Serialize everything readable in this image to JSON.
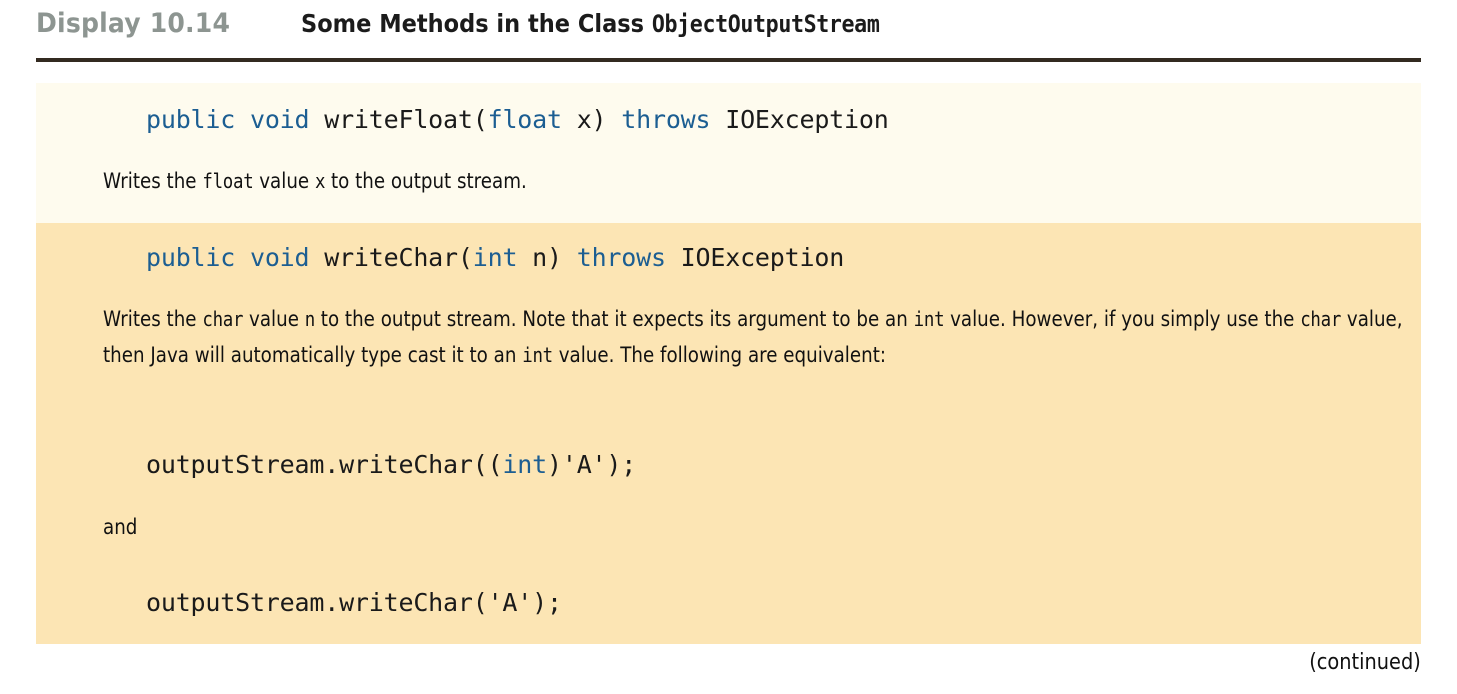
{
  "header": {
    "display_label": "Display 10.14",
    "title_text": "Some Methods in the Class ",
    "title_class_name": "ObjectOutputStream"
  },
  "colors": {
    "cream_block": "#fefbee",
    "tan_block": "#fce5b4",
    "rule": "#332a20",
    "display_label": "#8d9591",
    "keyword_blue": "#1c5e92",
    "body_text": "#111111"
  },
  "blocks": [
    {
      "id": "writeFloat",
      "background": "cream",
      "signature": {
        "parts": [
          {
            "text": "public",
            "kind": "keyword"
          },
          {
            "text": " ",
            "kind": "plain"
          },
          {
            "text": "void",
            "kind": "keyword"
          },
          {
            "text": " writeFloat(",
            "kind": "plain"
          },
          {
            "text": "float",
            "kind": "keyword"
          },
          {
            "text": " x) ",
            "kind": "plain"
          },
          {
            "text": "throws",
            "kind": "keyword"
          },
          {
            "text": " IOException",
            "kind": "plain"
          }
        ],
        "plain_text": "public void writeFloat(float x) throws IOException"
      },
      "description": "Writes the float value x to the output stream.",
      "description_parts": [
        {
          "text": "Writes the ",
          "kind": "prose"
        },
        {
          "text": "float",
          "kind": "code"
        },
        {
          "text": " value ",
          "kind": "prose"
        },
        {
          "text": "x",
          "kind": "code"
        },
        {
          "text": " to the output stream.",
          "kind": "prose"
        }
      ]
    },
    {
      "id": "writeChar",
      "background": "tan",
      "signature": {
        "parts": [
          {
            "text": "public",
            "kind": "keyword"
          },
          {
            "text": " ",
            "kind": "plain"
          },
          {
            "text": "void",
            "kind": "keyword"
          },
          {
            "text": " writeChar(",
            "kind": "plain"
          },
          {
            "text": "int",
            "kind": "keyword"
          },
          {
            "text": " n) ",
            "kind": "plain"
          },
          {
            "text": "throws",
            "kind": "keyword"
          },
          {
            "text": " IOException",
            "kind": "plain"
          }
        ],
        "plain_text": "public void writeChar(int n) throws IOException"
      },
      "description": "Writes the char value n to the output stream. Note that it expects its argument to be an int value. However, if you simply use the char value, then Java will automatically type cast it to an int value. The following are equivalent:",
      "description_parts": [
        {
          "text": "Writes the ",
          "kind": "prose"
        },
        {
          "text": "char",
          "kind": "code"
        },
        {
          "text": " value ",
          "kind": "prose"
        },
        {
          "text": "n",
          "kind": "code"
        },
        {
          "text": " to the output stream. Note that it expects its argument to be an ",
          "kind": "prose"
        },
        {
          "text": "int",
          "kind": "code"
        },
        {
          "text": " value. However, if you simply use the ",
          "kind": "prose"
        },
        {
          "text": "char",
          "kind": "code"
        },
        {
          "text": " value, then Java will automatically type cast it to an ",
          "kind": "prose"
        },
        {
          "text": "int",
          "kind": "code"
        },
        {
          "text": " value. The following are equivalent:",
          "kind": "prose"
        }
      ],
      "example_one": {
        "parts": [
          {
            "text": "outputStream.writeChar((",
            "kind": "plain"
          },
          {
            "text": "int",
            "kind": "keyword"
          },
          {
            "text": ")'A');",
            "kind": "plain"
          }
        ],
        "plain_text": "outputStream.writeChar((int)'A');"
      },
      "conjunction": "and",
      "example_two": {
        "parts": [
          {
            "text": "outputStream.writeChar('A');",
            "kind": "plain"
          }
        ],
        "plain_text": "outputStream.writeChar('A');"
      }
    }
  ],
  "footer": {
    "continued_note": "(continued)"
  }
}
